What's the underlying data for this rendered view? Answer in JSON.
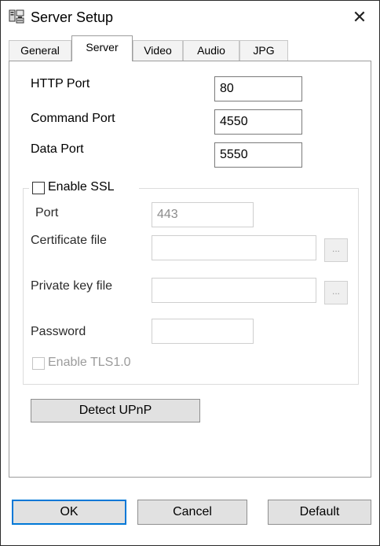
{
  "window": {
    "title": "Server Setup",
    "close_glyph": "✕"
  },
  "tabs": [
    {
      "label": "General"
    },
    {
      "label": "Server"
    },
    {
      "label": "Video"
    },
    {
      "label": "Audio"
    },
    {
      "label": "JPG"
    }
  ],
  "active_tab": "Server",
  "ports": {
    "http_label": "HTTP Port",
    "http_value": "80",
    "command_label": "Command Port",
    "command_value": "4550",
    "data_label": "Data Port",
    "data_value": "5550"
  },
  "ssl": {
    "enable_label": "Enable SSL",
    "enabled": false,
    "port_label": "Port",
    "port_value": "443",
    "cert_label": "Certificate file",
    "cert_value": "",
    "key_label": "Private key file",
    "key_value": "",
    "browse_label": "...",
    "password_label": "Password",
    "password_value": "",
    "tls_label": "Enable TLS1.0",
    "tls_enabled": false
  },
  "detect_upnp_label": "Detect UPnP",
  "footer": {
    "ok_label": "OK",
    "cancel_label": "Cancel",
    "default_label": "Default"
  },
  "colors": {
    "focus": "#0078d7",
    "button": "#e1e1e1",
    "disabled_text": "#9b9b9b"
  },
  "icons": {
    "app": "server-setup-icon",
    "close": "close-icon"
  }
}
